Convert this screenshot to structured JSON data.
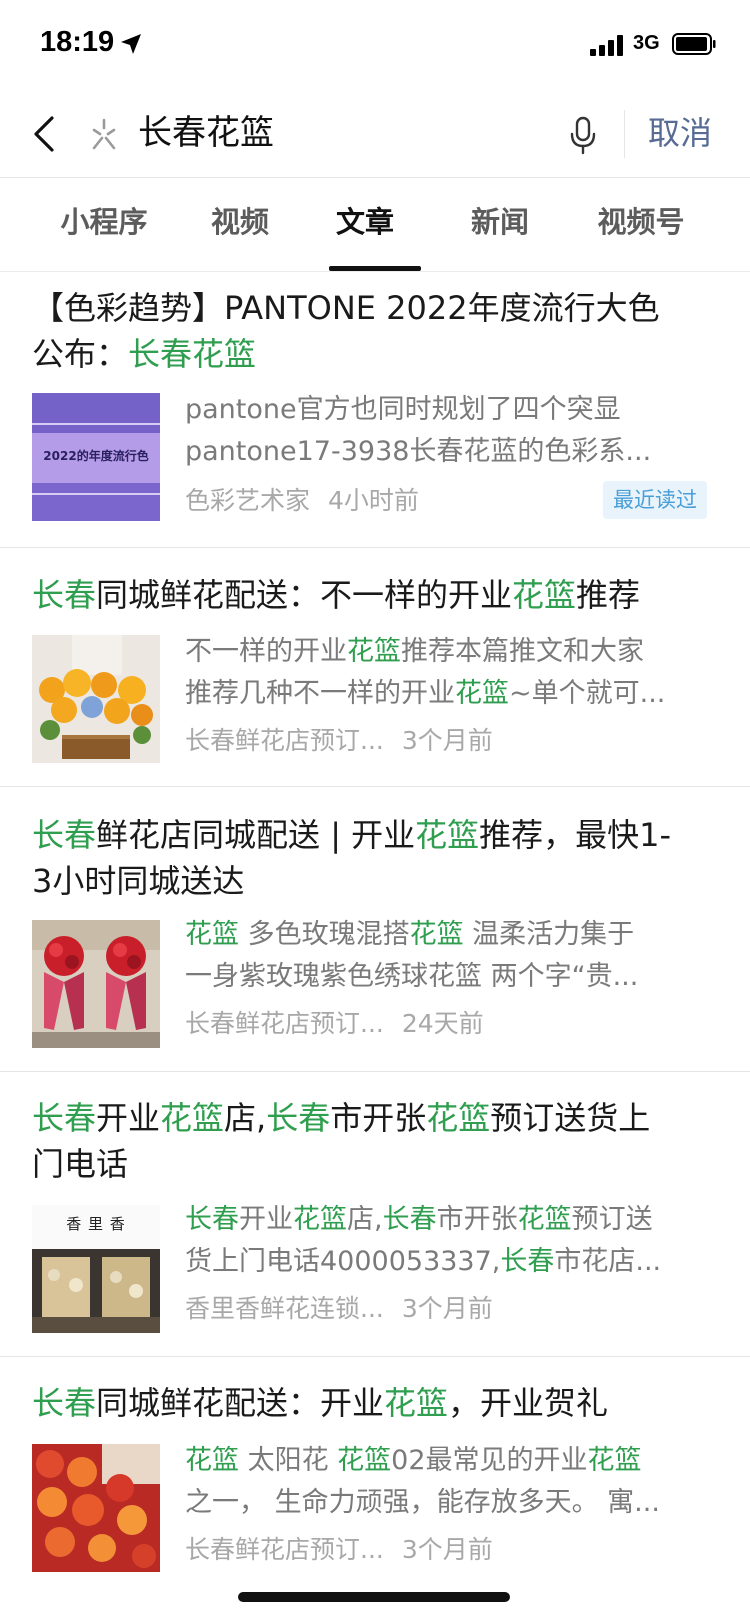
{
  "status_bar": {
    "time": "18:19",
    "network": "3G"
  },
  "search": {
    "query": "长春花篮",
    "cancel_label": "取消"
  },
  "tabs": [
    {
      "label": "小程序",
      "active": false
    },
    {
      "label": "视频",
      "active": false
    },
    {
      "label": "文章",
      "active": true
    },
    {
      "label": "新闻",
      "active": false
    },
    {
      "label": "视频号",
      "active": false
    }
  ],
  "results": [
    {
      "title_1a": "【色彩趋势】PANTONE 2022年度流行大色",
      "title_2a": "公布：",
      "title_2b": "长春花篮",
      "thumb_text": "2022的年度流行色",
      "snippet_1": "pantone官方也同时规划了四个突显",
      "snippet_2": "pantone17-3938长春花蓝的色彩系...",
      "source": "色彩艺术家",
      "time": "4小时前",
      "badge": "最近读过"
    },
    {
      "title_a": "长春",
      "title_b": "同城鲜花配送：不一样的开业",
      "title_c": "花篮",
      "title_d": "推荐",
      "snip1_a": "不一样的开业",
      "snip1_b": "花篮",
      "snip1_c": "推荐本篇推文和大家",
      "snip2_a": "推荐几种不一样的开业",
      "snip2_b": "花篮",
      "snip2_c": "~单个就可...",
      "source": "长春鲜花店预订...",
      "time": "3个月前"
    },
    {
      "title_a": "长春",
      "title_b": "鲜花店同城配送 | 开业",
      "title_c": "花篮",
      "title_d": "推荐，最快1-",
      "title_line2": "3小时同城送达",
      "snip1_a": "花篮",
      "snip1_b": " 多色玫瑰混搭",
      "snip1_c": "花篮",
      "snip1_d": " 温柔活力集于",
      "snip2": "一身紫玫瑰紫色绣球花篮 两个字“贵...",
      "source": "长春鲜花店预订...",
      "time": "24天前"
    },
    {
      "title_a": "长春",
      "title_b": "开业",
      "title_c": "花篮",
      "title_d": "店,",
      "title_e": "长春",
      "title_f": "市开张",
      "title_g": "花篮",
      "title_h": "预订送货上",
      "title_line2": "门电话",
      "thumb_sign": "香 里 香",
      "snip1_a": "长春",
      "snip1_b": "开业",
      "snip1_c": "花篮",
      "snip1_d": "店,",
      "snip1_e": "长春",
      "snip1_f": "市开张",
      "snip1_g": "花篮",
      "snip1_h": "预订送",
      "snip2_a": "货上门电话4000053337,",
      "snip2_b": "长春",
      "snip2_c": "市花店...",
      "source": "香里香鲜花连锁...",
      "time": "3个月前"
    },
    {
      "title_a": "长春",
      "title_b": "同城鲜花配送：开业",
      "title_c": "花篮",
      "title_d": "，开业贺礼",
      "snip1_a": "花篮",
      "snip1_b": " 太阳花 ",
      "snip1_c": "花篮",
      "snip1_d": "02最常见的开业",
      "snip1_e": "花篮",
      "snip2": "之一， 生命力顽强，能存放多天。 寓...",
      "source": "长春鲜花店预订...",
      "time": "3个月前"
    }
  ],
  "colors": {
    "highlight": "#2f9e4f",
    "cancel": "#576b95",
    "badge": "#4a9fd8"
  }
}
